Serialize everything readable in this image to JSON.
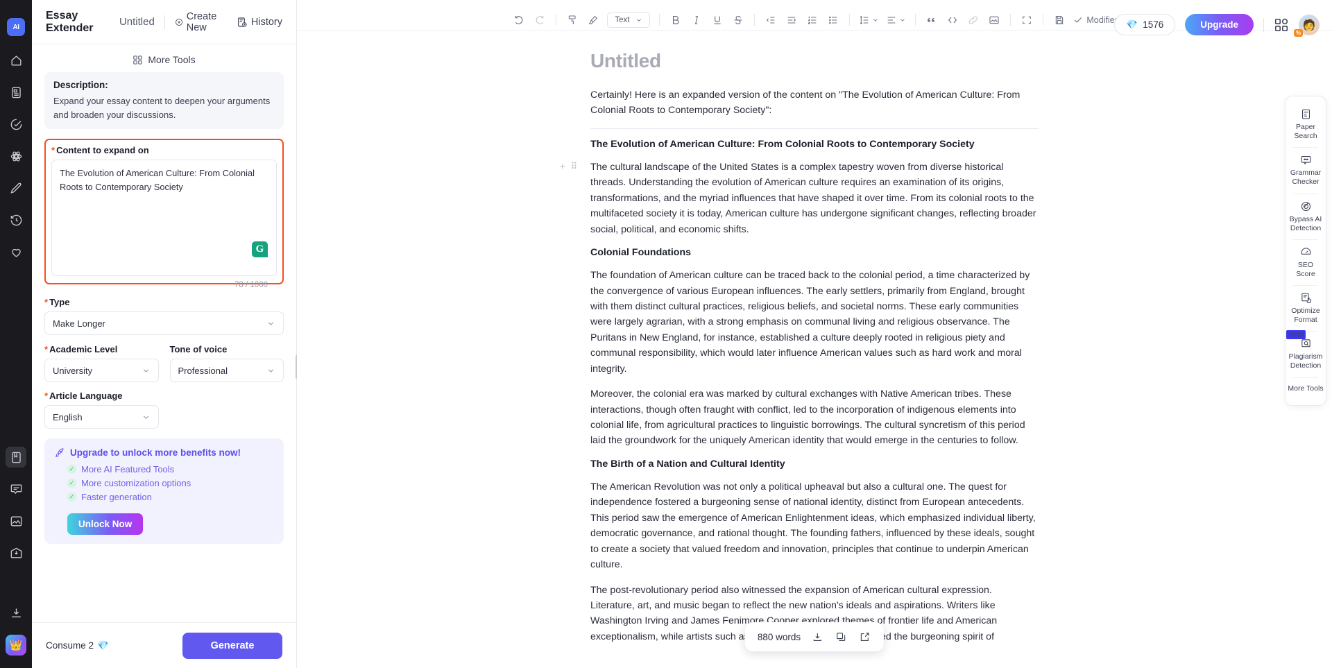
{
  "rail": {
    "logo_label": "AI",
    "items": [
      {
        "name": "home-icon",
        "label": "Home"
      },
      {
        "name": "documents-icon",
        "label": "Documents"
      },
      {
        "name": "checkmark-circle-icon",
        "label": "Checker"
      },
      {
        "name": "atom-icon",
        "label": "AI Lab"
      },
      {
        "name": "pencil-icon",
        "label": "Write"
      },
      {
        "name": "history-clock-icon",
        "label": "History"
      },
      {
        "name": "heart-icon",
        "label": "Favorites"
      }
    ],
    "lower_items": [
      {
        "name": "book-icon",
        "label": "Library",
        "active": true
      },
      {
        "name": "chat-bubble-icon",
        "label": "Chat"
      },
      {
        "name": "image-icon",
        "label": "Images"
      },
      {
        "name": "inbox-download-icon",
        "label": "Inbox"
      }
    ],
    "bottom_items": [
      {
        "name": "download-icon",
        "label": "Download App"
      },
      {
        "name": "crown-icon",
        "label": "Premium"
      }
    ]
  },
  "header": {
    "app_title": "Essay Extender",
    "doc_name": "Untitled",
    "create_new": "Create New",
    "history": "History",
    "gem_count": "1576",
    "upgrade_label": "Upgrade"
  },
  "left_panel": {
    "more_tools": "More Tools",
    "description_label": "Description:",
    "description_text": "Expand your essay content to deepen your arguments and broaden your discussions.",
    "content_field": {
      "label": "Content to expand on",
      "required": true,
      "value": "The Evolution of American Culture: From Colonial Roots to Contemporary Society",
      "char_count": "78 / 1000",
      "grammarly_badge": "G"
    },
    "type_field": {
      "label": "Type",
      "required": true,
      "value": "Make Longer"
    },
    "academic_level_field": {
      "label": "Academic Level",
      "required": true,
      "value": "University"
    },
    "tone_field": {
      "label": "Tone of voice",
      "required": false,
      "value": "Professional"
    },
    "language_field": {
      "label": "Article Language",
      "required": true,
      "value": "English"
    },
    "promo": {
      "heading": "Upgrade to unlock more benefits now!",
      "benefits": [
        "More AI Featured Tools",
        "More customization options",
        "Faster generation"
      ],
      "cta": "Unlock Now"
    },
    "footer": {
      "consume": "Consume 2",
      "generate": "Generate"
    }
  },
  "toolbar": {
    "undo": "Undo",
    "redo": "Redo",
    "format_painter": "Format Painter",
    "clear_format": "Clear Formatting",
    "style_select": "Text",
    "bold": "Bold",
    "italic": "Italic",
    "underline": "Underline",
    "strikethrough": "Strikethrough",
    "outdent": "Outdent",
    "indent": "Indent",
    "ordered_list": "Ordered List",
    "bullet_list": "Bullet List",
    "line_height": "Line Height",
    "align": "Align",
    "quote": "Quote",
    "code": "Code",
    "link": "Link",
    "image": "Image",
    "fullscreen": "Fullscreen",
    "save": "Save",
    "status": "Modified"
  },
  "document": {
    "title": "Untitled",
    "blocks": [
      {
        "type": "p",
        "text": "Certainly! Here is an expanded version of the content on \"The Evolution of American Culture: From Colonial Roots to Contemporary Society\":"
      },
      {
        "type": "rule"
      },
      {
        "type": "h3",
        "text": "The Evolution of American Culture: From Colonial Roots to Contemporary Society"
      },
      {
        "type": "p",
        "handles": true,
        "text": "The cultural landscape of the United States is a complex tapestry woven from diverse historical threads. Understanding the evolution of American culture requires an examination of its origins, transformations, and the myriad influences that have shaped it over time. From its colonial roots to the multifaceted society it is today, American culture has undergone significant changes, reflecting broader social, political, and economic shifts."
      },
      {
        "type": "h3",
        "text": "Colonial Foundations"
      },
      {
        "type": "p",
        "text": "The foundation of American culture can be traced back to the colonial period, a time characterized by the convergence of various European influences. The early settlers, primarily from England, brought with them distinct cultural practices, religious beliefs, and societal norms. These early communities were largely agrarian, with a strong emphasis on communal living and religious observance. The Puritans in New England, for instance, established a culture deeply rooted in religious piety and communal responsibility, which would later influence American values such as hard work and moral integrity."
      },
      {
        "type": "p",
        "text": "Moreover, the colonial era was marked by cultural exchanges with Native American tribes. These interactions, though often fraught with conflict, led to the incorporation of indigenous elements into colonial life, from agricultural practices to linguistic borrowings. The cultural syncretism of this period laid the groundwork for the uniquely American identity that would emerge in the centuries to follow."
      },
      {
        "type": "h3",
        "text": "The Birth of a Nation and Cultural Identity"
      },
      {
        "type": "p",
        "text": "The American Revolution was not only a political upheaval but also a cultural one. The quest for independence fostered a burgeoning sense of national identity, distinct from European antecedents. This period saw the emergence of American Enlightenment ideas, which emphasized individual liberty, democratic governance, and rational thought. The founding fathers, influenced by these ideals, sought to create a society that valued freedom and innovation, principles that continue to underpin American culture."
      },
      {
        "type": "p",
        "text": "The post-revolutionary period also witnessed the expansion of American cultural expression. Literature, art, and music began to reflect the new nation's ideals and aspirations. Writers like Washington Irving and James Fenimore Cooper explored themes of frontier life and American exceptionalism, while artists such as John Singleton Copley captured the burgeoning spirit of"
      }
    ]
  },
  "word_bar": {
    "word_count": "880 words",
    "download": "Download",
    "copy": "Copy",
    "share": "Share"
  },
  "right_panel": {
    "tools": [
      {
        "name": "paper-search-icon",
        "label": "Paper Search",
        "badge": ""
      },
      {
        "name": "grammar-checker-icon",
        "label": "Grammar Checker",
        "badge": ""
      },
      {
        "name": "bypass-ai-icon",
        "label": "Bypass AI Detection",
        "badge": ""
      },
      {
        "name": "seo-score-icon",
        "label": "SEO Score",
        "badge": ""
      },
      {
        "name": "optimize-format-icon",
        "label": "Optimize Format",
        "badge": ""
      },
      {
        "name": "plagiarism-icon",
        "label": "Plagiarism Detection",
        "badge": "Beta"
      },
      {
        "name": "more-tools-icon",
        "label": "More Tools",
        "badge": ""
      }
    ]
  },
  "colors": {
    "accent_purple": "#6159ef",
    "highlight_red": "#f4501e",
    "promo_bg": "#f2f1fe",
    "rail_bg": "#1b1b1f",
    "grammarly_green": "#15a37f"
  }
}
